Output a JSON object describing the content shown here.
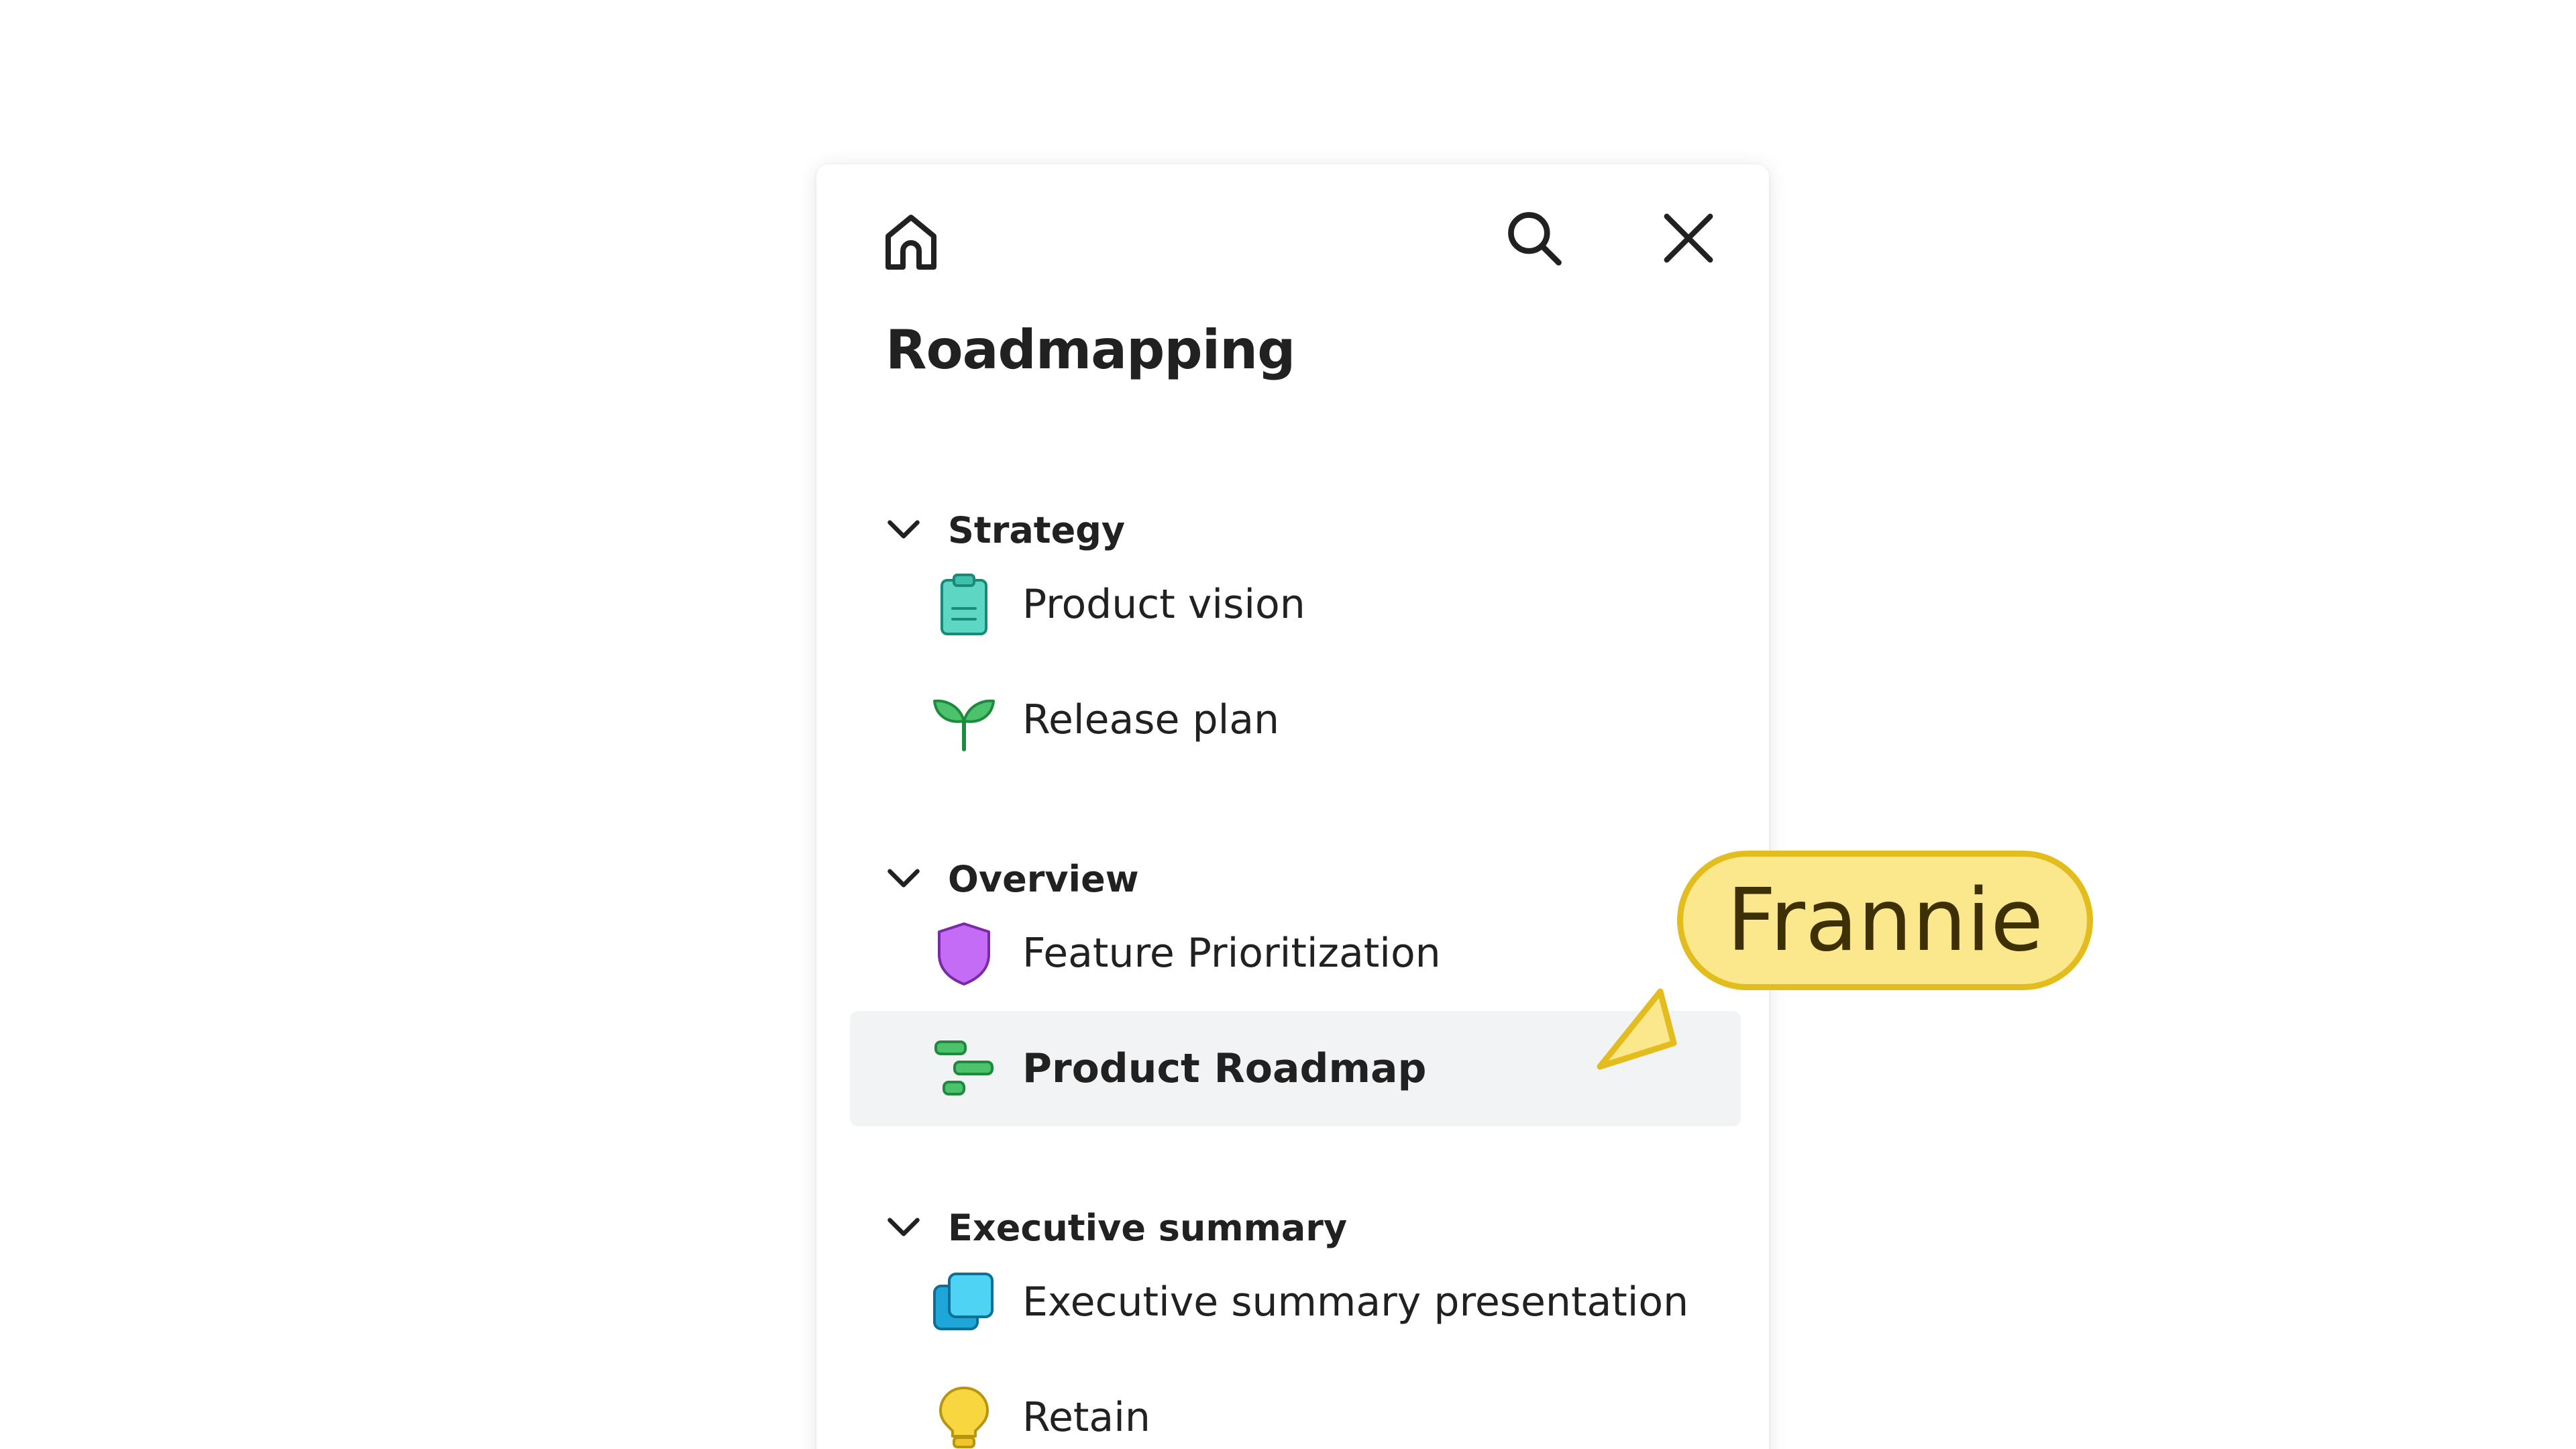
{
  "header": {
    "home_icon": "home-icon",
    "search_icon": "search-icon",
    "close_icon": "close-icon"
  },
  "title": "Roadmapping",
  "sections": [
    {
      "label": "Strategy",
      "items": [
        {
          "label": "Product vision",
          "icon": "clipboard-icon"
        },
        {
          "label": "Release plan",
          "icon": "sprout-icon"
        }
      ]
    },
    {
      "label": "Overview",
      "items": [
        {
          "label": "Feature Prioritization",
          "icon": "shield-icon"
        },
        {
          "label": "Product Roadmap",
          "icon": "roadmap-bars-icon",
          "selected": true
        }
      ]
    },
    {
      "label": "Executive summary",
      "items": [
        {
          "label": "Executive summary presentation",
          "icon": "slides-icon"
        },
        {
          "label": "Retain",
          "icon": "lightbulb-icon"
        }
      ]
    }
  ],
  "collaborator": {
    "name": "Frannie",
    "tag_color": "#fbe78c",
    "border_color": "#e3bc1e"
  },
  "colors": {
    "selected_row": "#f2f3f5",
    "text": "#212121"
  }
}
